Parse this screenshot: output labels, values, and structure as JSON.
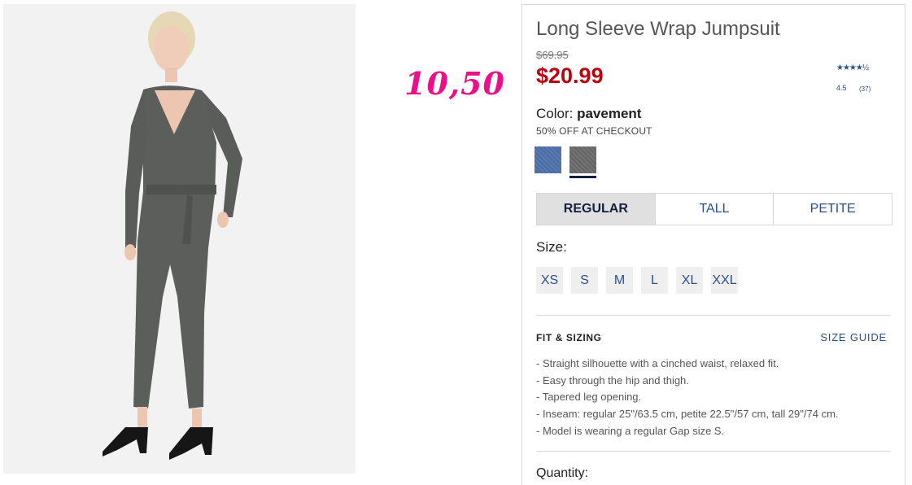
{
  "annotation": {
    "text": "10,50",
    "color": "#ec0f8a"
  },
  "product": {
    "title": "Long Sleeve Wrap Jumpsuit",
    "old_price": "$69.95",
    "sale_price": "$20.99",
    "rating": {
      "stars": "★★★★½",
      "value": "4.5",
      "count": "(37)"
    },
    "color_label": "Color: ",
    "color_value": "pavement",
    "promo": "50% OFF AT CHECKOUT",
    "swatches": [
      {
        "name": "blue",
        "color": "#4e72ab",
        "selected": false
      },
      {
        "name": "pavement",
        "color": "#6a6a6a",
        "selected": true
      }
    ]
  },
  "fit_tabs": [
    {
      "label": "REGULAR",
      "selected": true
    },
    {
      "label": "TALL",
      "selected": false
    },
    {
      "label": "PETITE",
      "selected": false
    }
  ],
  "size": {
    "label": "Size:",
    "options": [
      "XS",
      "S",
      "M",
      "L",
      "XL",
      "XXL"
    ]
  },
  "fit_sizing": {
    "heading": "FIT & SIZING",
    "guide_link": "SIZE GUIDE",
    "details": [
      "- Straight silhouette with a cinched waist, relaxed fit.",
      "- Easy through the hip and thigh.",
      "- Tapered leg opening.",
      "- Inseam: regular 25\"/63.5 cm, petite 22.5\"/57 cm, tall 29\"/74 cm.",
      "- Model is wearing a regular Gap size S."
    ]
  },
  "quantity_label": "Quantity:",
  "colors": {
    "sale_red": "#c0000e",
    "link_blue": "#2a4f8b",
    "navy": "#0d1f40"
  }
}
